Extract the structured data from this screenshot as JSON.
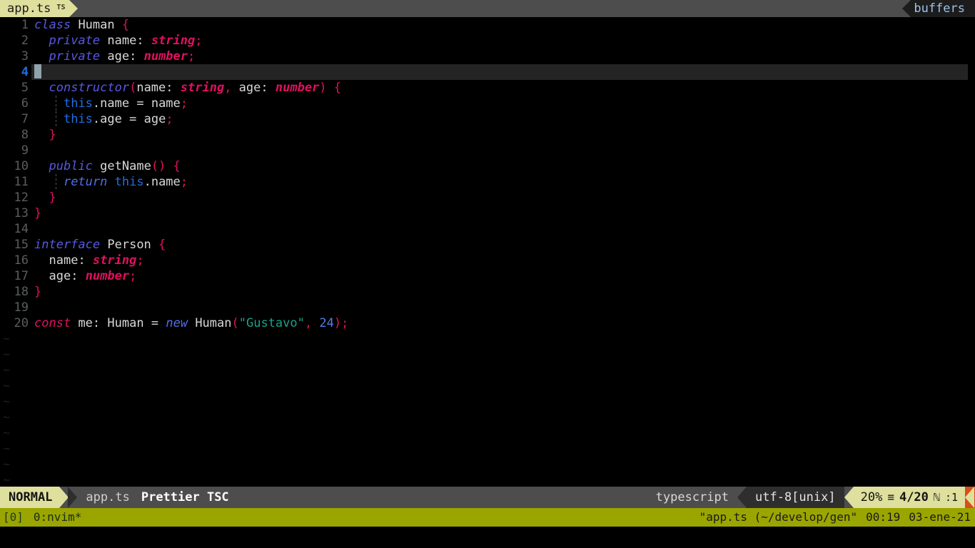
{
  "tabline": {
    "tab": {
      "name": "app.ts",
      "badge": "TS"
    },
    "buffers_label": "buffers",
    "tab_bg": "#dfdf9e",
    "bar_bg": "#4d4d4d"
  },
  "editor": {
    "filetype": "typescript",
    "cursor_line": 4,
    "total_lines": 20,
    "lines": [
      {
        "n": "1",
        "tokens": [
          {
            "t": "class",
            "c": "kw"
          },
          {
            "t": " ",
            "c": "op"
          },
          {
            "t": "Human",
            "c": "id"
          },
          {
            "t": " ",
            "c": "op"
          },
          {
            "t": "{",
            "c": "pun"
          }
        ]
      },
      {
        "n": "2",
        "tokens": [
          {
            "t": "  ",
            "c": "op"
          },
          {
            "t": "private",
            "c": "kw"
          },
          {
            "t": " ",
            "c": "op"
          },
          {
            "t": "name",
            "c": "id"
          },
          {
            "t": ": ",
            "c": "op"
          },
          {
            "t": "string",
            "c": "typ"
          },
          {
            "t": ";",
            "c": "pun"
          }
        ]
      },
      {
        "n": "3",
        "tokens": [
          {
            "t": "  ",
            "c": "op"
          },
          {
            "t": "private",
            "c": "kw"
          },
          {
            "t": " ",
            "c": "op"
          },
          {
            "t": "age",
            "c": "id"
          },
          {
            "t": ": ",
            "c": "op"
          },
          {
            "t": "number",
            "c": "typ"
          },
          {
            "t": ";",
            "c": "pun"
          }
        ]
      },
      {
        "n": "4",
        "tokens": [],
        "cursor": true
      },
      {
        "n": "5",
        "tokens": [
          {
            "t": "  ",
            "c": "op"
          },
          {
            "t": "constructor",
            "c": "kw"
          },
          {
            "t": "(",
            "c": "pun"
          },
          {
            "t": "name",
            "c": "id"
          },
          {
            "t": ": ",
            "c": "op"
          },
          {
            "t": "string",
            "c": "typ"
          },
          {
            "t": ", ",
            "c": "pun"
          },
          {
            "t": "age",
            "c": "id"
          },
          {
            "t": ": ",
            "c": "op"
          },
          {
            "t": "number",
            "c": "typ"
          },
          {
            "t": ")",
            "c": "pun"
          },
          {
            "t": " ",
            "c": "op"
          },
          {
            "t": "{",
            "c": "pun"
          }
        ]
      },
      {
        "n": "6",
        "indent": true,
        "tokens": [
          {
            "t": "    ",
            "c": "op"
          },
          {
            "t": "this",
            "c": "this"
          },
          {
            "t": ".",
            "c": "op"
          },
          {
            "t": "name",
            "c": "id"
          },
          {
            "t": " = ",
            "c": "op"
          },
          {
            "t": "name",
            "c": "id"
          },
          {
            "t": ";",
            "c": "pun"
          }
        ]
      },
      {
        "n": "7",
        "indent": true,
        "tokens": [
          {
            "t": "    ",
            "c": "op"
          },
          {
            "t": "this",
            "c": "this"
          },
          {
            "t": ".",
            "c": "op"
          },
          {
            "t": "age",
            "c": "id"
          },
          {
            "t": " = ",
            "c": "op"
          },
          {
            "t": "age",
            "c": "id"
          },
          {
            "t": ";",
            "c": "pun"
          }
        ]
      },
      {
        "n": "8",
        "tokens": [
          {
            "t": "  ",
            "c": "op"
          },
          {
            "t": "}",
            "c": "pun"
          }
        ]
      },
      {
        "n": "9",
        "tokens": []
      },
      {
        "n": "10",
        "tokens": [
          {
            "t": "  ",
            "c": "op"
          },
          {
            "t": "public",
            "c": "kw"
          },
          {
            "t": " ",
            "c": "op"
          },
          {
            "t": "getName",
            "c": "id"
          },
          {
            "t": "()",
            "c": "pun"
          },
          {
            "t": " ",
            "c": "op"
          },
          {
            "t": "{",
            "c": "pun"
          }
        ]
      },
      {
        "n": "11",
        "indent": true,
        "tokens": [
          {
            "t": "    ",
            "c": "op"
          },
          {
            "t": "return",
            "c": "kw2"
          },
          {
            "t": " ",
            "c": "op"
          },
          {
            "t": "this",
            "c": "this"
          },
          {
            "t": ".",
            "c": "op"
          },
          {
            "t": "name",
            "c": "id"
          },
          {
            "t": ";",
            "c": "pun"
          }
        ]
      },
      {
        "n": "12",
        "tokens": [
          {
            "t": "  ",
            "c": "op"
          },
          {
            "t": "}",
            "c": "pun"
          }
        ]
      },
      {
        "n": "13",
        "tokens": [
          {
            "t": "}",
            "c": "pun"
          }
        ]
      },
      {
        "n": "14",
        "tokens": []
      },
      {
        "n": "15",
        "tokens": [
          {
            "t": "interface",
            "c": "kw"
          },
          {
            "t": " ",
            "c": "op"
          },
          {
            "t": "Person",
            "c": "id"
          },
          {
            "t": " ",
            "c": "op"
          },
          {
            "t": "{",
            "c": "pun"
          }
        ]
      },
      {
        "n": "16",
        "tokens": [
          {
            "t": "  ",
            "c": "op"
          },
          {
            "t": "name",
            "c": "id"
          },
          {
            "t": ": ",
            "c": "op"
          },
          {
            "t": "string",
            "c": "typ"
          },
          {
            "t": ";",
            "c": "pun"
          }
        ]
      },
      {
        "n": "17",
        "tokens": [
          {
            "t": "  ",
            "c": "op"
          },
          {
            "t": "age",
            "c": "id"
          },
          {
            "t": ": ",
            "c": "op"
          },
          {
            "t": "number",
            "c": "typ"
          },
          {
            "t": ";",
            "c": "pun"
          }
        ]
      },
      {
        "n": "18",
        "tokens": [
          {
            "t": "}",
            "c": "pun"
          }
        ]
      },
      {
        "n": "19",
        "tokens": []
      },
      {
        "n": "20",
        "tokens": [
          {
            "t": "const",
            "c": "kwc"
          },
          {
            "t": " ",
            "c": "op"
          },
          {
            "t": "me",
            "c": "id"
          },
          {
            "t": ": ",
            "c": "op"
          },
          {
            "t": "Human",
            "c": "id"
          },
          {
            "t": " ",
            "c": "op"
          },
          {
            "t": "=",
            "c": "op"
          },
          {
            "t": " ",
            "c": "op"
          },
          {
            "t": "new",
            "c": "kw2"
          },
          {
            "t": " ",
            "c": "op"
          },
          {
            "t": "Human",
            "c": "id"
          },
          {
            "t": "(",
            "c": "pun"
          },
          {
            "t": "\"Gustavo\"",
            "c": "str"
          },
          {
            "t": ",",
            "c": "pun"
          },
          {
            "t": " ",
            "c": "op"
          },
          {
            "t": "24",
            "c": "num"
          },
          {
            "t": ");",
            "c": "pun"
          }
        ]
      }
    ],
    "tilde_count": 10,
    "tilde_char": "~"
  },
  "statusline": {
    "mode": "NORMAL",
    "file": "app.ts",
    "tools": "Prettier TSC",
    "filetype": "typescript",
    "encoding": "utf-8[unix]",
    "percent": "20%",
    "lines_glyph": "≡",
    "line_position": "4/20",
    "column_glyph": "ℕ",
    "column": ":1",
    "mode_bg": "#dfdf9e",
    "accent_end": "#d94f17"
  },
  "tmux": {
    "session": "[0]",
    "window": "0:nvim*",
    "title": "\"app.ts (~/develop/gen\"",
    "time": "00:19",
    "date": "03-ene-21",
    "bg": "#9aa500"
  }
}
